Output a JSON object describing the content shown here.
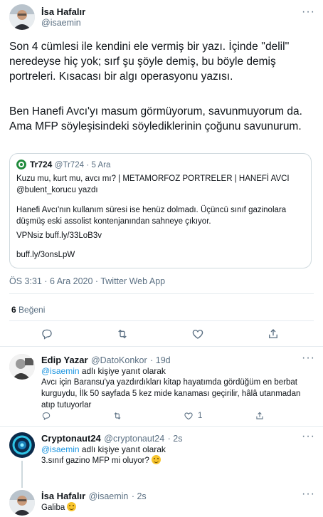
{
  "main_tweet": {
    "name": "İsa Hafalır",
    "handle": "@isaemin",
    "text_p1": "Son 4 cümlesi ile kendini ele vermiş bir yazı. İçinde ''delil'' neredeyse hiç yok; sırf şu şöyle demiş, bu böyle demiş portreleri. Kısacası bir algı operasyonu yazısı.",
    "text_p2": "Ben Hanefi Avcı'yı masum görmüyorum, savunmuyorum da. Ama MFP söyleşisindeki söylediklerinin çoğunu savunurum.",
    "quote": {
      "name": "Tr724",
      "handle": "@Tr724",
      "dot": "·",
      "date": "5 Ara",
      "line1": "Kuzu mu, kurt mu, avcı mı? | METAMORFOZ PORTRELER | HANEFİ AVCI",
      "line2": "@bulent_korucu yazdı",
      "line3": "Hanefi Avcı'nın kullanım süresi ise henüz dolmadı. Üçüncü sınıf gazinolara düşmüş eski assolist kontenjanından sahneye çıkıyor.",
      "line4": "VPNsiz buff.ly/33LoB3v",
      "line5": "buff.ly/3onsLpW"
    },
    "meta": "ÖS 3:31 · 6 Ara 2020 · Twitter Web App",
    "likes_count": "6",
    "likes_label": "Beğeni"
  },
  "replies": [
    {
      "name": "Edip Yazar",
      "handle": "@DatoKonkor",
      "time": "· 19d",
      "reply_to_mention": "@isaemin",
      "reply_to_suffix": "adlı kişiye yanıt olarak",
      "text": "Avcı için Baransu'ya yazdırdıkları kitap hayatımda gördüğüm en berbat kurguydu, İlk 50 sayfada 5 kez mide kanaması geçirilir, hâlâ utanmadan atıp tutuyorlar",
      "like_count": "1"
    },
    {
      "name": "Cryptonaut24",
      "handle": "@cryptonaut24",
      "time": "· 2s",
      "reply_to_mention": "@isaemin",
      "reply_to_suffix": "adlı kişiye yanıt olarak",
      "text": "3.sınıf gazino MFP mi oluyor?"
    },
    {
      "name": "İsa Hafalır",
      "handle": "@isaemin",
      "time": "· 2s",
      "text": "Galiba"
    }
  ],
  "more_label": "···",
  "colors": {
    "accent": "#1b95e0",
    "secondary": "#5b7083",
    "border": "#e6ecf0"
  },
  "icons": [
    "reply-icon",
    "retweet-icon",
    "like-icon",
    "share-icon",
    "more-icon",
    "grinning-emoji-icon"
  ]
}
